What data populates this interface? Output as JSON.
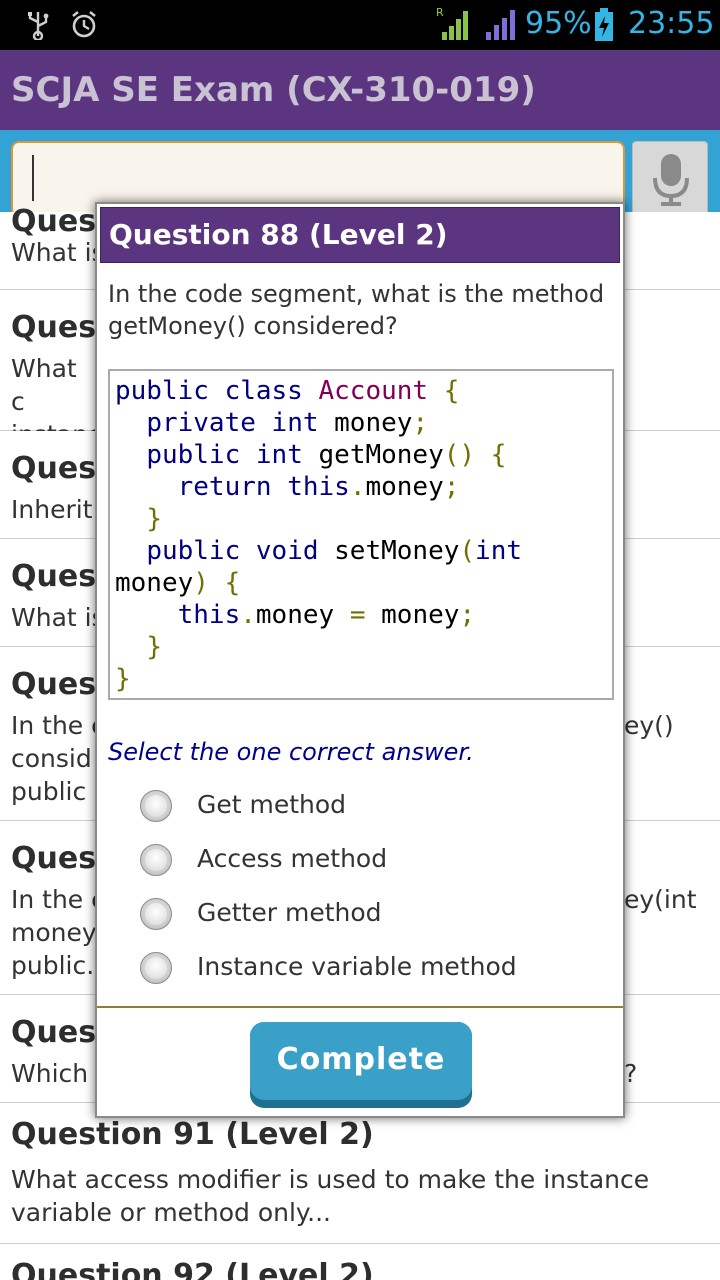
{
  "status_bar": {
    "battery": "95%",
    "time": "23:55",
    "roaming_indicator": "R",
    "icons": [
      "usb-icon",
      "alarm-icon",
      "signal-roaming-icon",
      "signal-icon",
      "battery-charging-icon"
    ]
  },
  "app": {
    "title": "SCJA SE Exam (CX-310-019)",
    "brand_color": "#5c3580",
    "accent_color": "#33a3d6"
  },
  "search": {
    "value": "",
    "mic_icon": "microphone-icon"
  },
  "list": {
    "items": [
      {
        "title": "Ques",
        "desc": "What is"
      },
      {
        "title": "Ques",
        "desc": "What c instanc"
      },
      {
        "title": "Ques",
        "desc": "Inherit"
      },
      {
        "title": "Ques",
        "desc": "What is"
      },
      {
        "title": "Ques",
        "desc_1": "In the c",
        "desc_2": "consid",
        "desc_3": "public",
        "desc_right": "ey()"
      },
      {
        "title": "Ques",
        "desc_1": "In the c",
        "desc_2": "money",
        "desc_3": "public.",
        "desc_right": "ey(int"
      },
      {
        "title": "Ques",
        "desc": "Which",
        "desc_right": "?"
      },
      {
        "title": "Question 91 (Level 2)",
        "desc": "What access modifier is used to make the instance variable or method only..."
      },
      {
        "title": "Question 92 (Level 2)"
      }
    ]
  },
  "dialog": {
    "title": "Question 88 (Level 2)",
    "question": "In the code segment, what is the method getMoney() considered?",
    "code": {
      "l1_a": "public class",
      "l1_b": "Account",
      "l1_c": "{",
      "l2_a": "private int",
      "l2_b": "money",
      "l2_c": ";",
      "l3_a": "public int",
      "l3_b": "getMoney",
      "l3_c": "() {",
      "l4_a": "return this",
      "l4_b": ".",
      "l4_c": "money",
      "l4_d": ";",
      "l5": "}",
      "l6_a": "public void",
      "l6_b": "setMoney",
      "l6_c": "(",
      "l6_d": "int",
      "l7_a": "money",
      "l7_b": ") {",
      "l8_a": "this",
      "l8_b": ".",
      "l8_c": "money",
      "l8_d": "=",
      "l8_e": "money",
      "l8_f": ";",
      "l9": "}",
      "l10": "}"
    },
    "instruction": "Select the one correct answer.",
    "options": [
      "Get method",
      "Access method",
      "Getter method",
      "Instance variable method"
    ],
    "complete_label": "Complete"
  }
}
